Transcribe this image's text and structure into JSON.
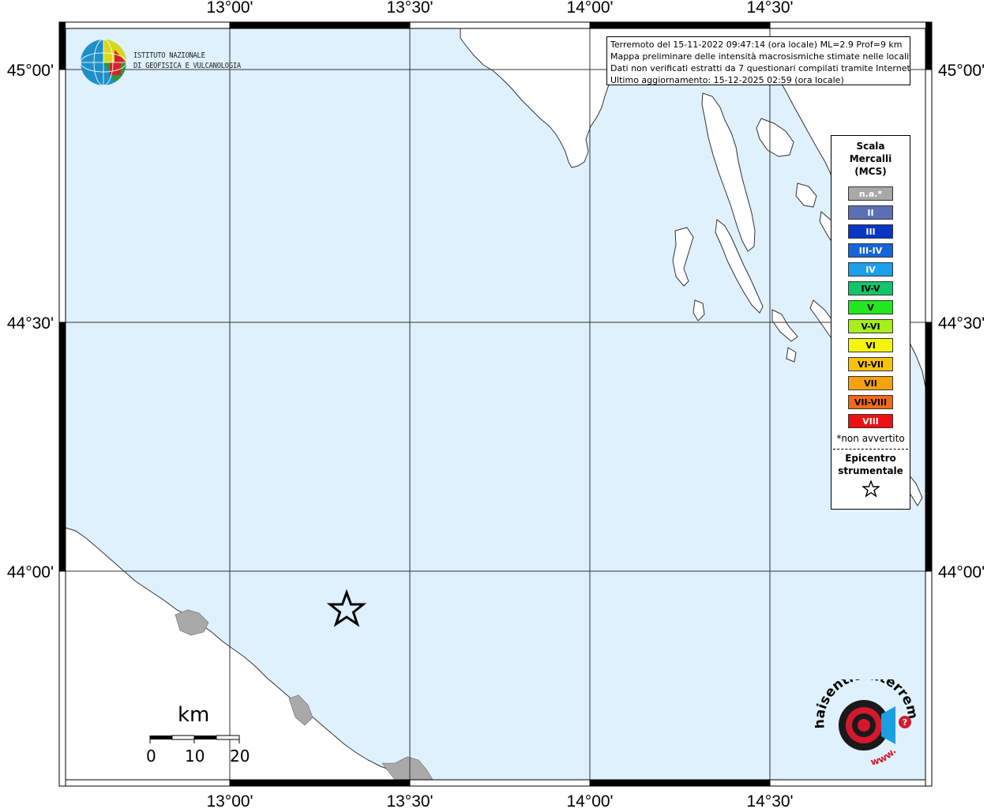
{
  "map": {
    "longitude_labels_top": [
      "13°00'",
      "13°30'",
      "14°00'",
      "14°30'"
    ],
    "longitude_labels_bottom": [
      "13°00'",
      "13°30'",
      "14°00'",
      "14°30'"
    ],
    "latitude_labels_left": [
      "45°00'",
      "44°30'",
      "44°00'"
    ],
    "latitude_labels_right": [
      "45°00'",
      "44°30'",
      "44°00'"
    ],
    "sea_color": "#dff1fd",
    "land_color": "#ffffff",
    "urban_color": "#a9a9a9",
    "epicenter_marker": "star-icon"
  },
  "info": {
    "line1": "Terremoto del 15-11-2022 09:47:14 (ora locale) ML=2.9 Prof=9 km",
    "line2": "Mappa preliminare delle intensità macrosismiche stimate nelle località",
    "line3": "Dati non verificati estratti da 7 questionari compilati tramite Internet.",
    "line4": "Ultimo aggiornamento: 15-12-2025 02:59 (ora locale)"
  },
  "legend": {
    "title_line1": "Scala",
    "title_line2": "Mercalli",
    "title_line3": "(MCS)",
    "items": [
      {
        "label": "n.a.*",
        "color": "#a8a8a8",
        "text_color": "#ffffff"
      },
      {
        "label": "II",
        "color": "#5b6fb5",
        "text_color": "#ffffff"
      },
      {
        "label": "III",
        "color": "#0a36c4",
        "text_color": "#ffffff"
      },
      {
        "label": "III-IV",
        "color": "#1565d8",
        "text_color": "#ffffff"
      },
      {
        "label": "IV",
        "color": "#1aa0ec",
        "text_color": "#ffffff"
      },
      {
        "label": "IV-V",
        "color": "#12c46a",
        "text_color": "#000000"
      },
      {
        "label": "V",
        "color": "#1fe81f",
        "text_color": "#000000"
      },
      {
        "label": "V-VI",
        "color": "#a8ee1a",
        "text_color": "#000000"
      },
      {
        "label": "VI",
        "color": "#f5f50c",
        "text_color": "#000000"
      },
      {
        "label": "VI-VII",
        "color": "#f6c20c",
        "text_color": "#000000"
      },
      {
        "label": "VII",
        "color": "#f6a20c",
        "text_color": "#000000"
      },
      {
        "label": "VII-VIII",
        "color": "#f46a14",
        "text_color": "#000000"
      },
      {
        "label": "VIII",
        "color": "#ee1010",
        "text_color": "#ffffff"
      }
    ],
    "note": "*non avvertito",
    "epicenter_line1": "Epicentro",
    "epicenter_line2": "strumentale"
  },
  "ingv": {
    "line1": "ISTITUTO NAZIONALE",
    "line2": "DI GEOFISICA E VULCANOLOGIA"
  },
  "scale": {
    "unit": "km",
    "ticks": [
      "0",
      "10",
      "20"
    ]
  },
  "hst_logo": {
    "top_text": "haisentitoilterremoto.it",
    "bottom_text": "www.",
    "accent_color": "#d4182c"
  }
}
